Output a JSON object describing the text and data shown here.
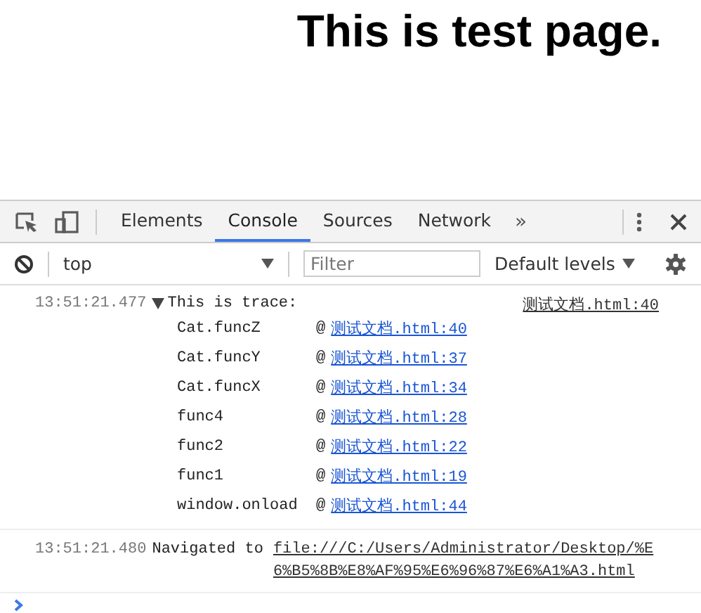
{
  "page": {
    "heading": "This is test page."
  },
  "devtools": {
    "tabs": [
      {
        "label": "Elements",
        "selected": false
      },
      {
        "label": "Console",
        "selected": true
      },
      {
        "label": "Sources",
        "selected": false
      },
      {
        "label": "Network",
        "selected": false
      }
    ],
    "more": "»",
    "context": "top",
    "filter": {
      "placeholder": "Filter"
    },
    "levels": "Default levels",
    "console": [
      {
        "kind": "trace",
        "time": "13:51:21.477",
        "expanded": true,
        "message": "This is trace:",
        "source": "测试文档.html:40",
        "frames": [
          {
            "function": "Cat.funcZ",
            "at": "@",
            "link": "测试文档.html:40"
          },
          {
            "function": "Cat.funcY",
            "at": "@",
            "link": "测试文档.html:37"
          },
          {
            "function": "Cat.funcX",
            "at": "@",
            "link": "测试文档.html:34"
          },
          {
            "function": "func4",
            "at": "@",
            "link": "测试文档.html:28"
          },
          {
            "function": "func2",
            "at": "@",
            "link": "测试文档.html:22"
          },
          {
            "function": "func1",
            "at": "@",
            "link": "测试文档.html:19"
          },
          {
            "function": "window.onload",
            "at": "@",
            "link": "测试文档.html:44"
          }
        ]
      },
      {
        "kind": "navigation",
        "time": "13:51:21.480",
        "message": "Navigated to",
        "url": "file:///C:/Users/Administrator/Desktop/%E6%B5%8B%E8%AF%95%E6%96%87%E6%A1%A3.html"
      }
    ]
  }
}
